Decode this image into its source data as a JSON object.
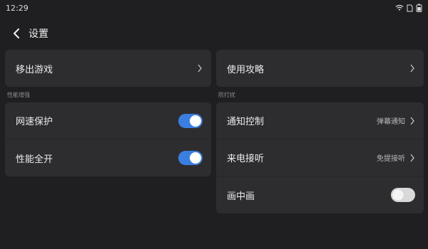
{
  "status": {
    "time": "12:29",
    "icons": [
      "wifi-icon",
      "sim-card-icon",
      "battery-icon"
    ]
  },
  "header": {
    "title": "设置",
    "back_icon": "chevron-left-icon"
  },
  "left": {
    "top_item": {
      "label": "移出游戏"
    },
    "section": "性能增强",
    "items": [
      {
        "label": "网速保护",
        "toggle": "on"
      },
      {
        "label": "性能全开",
        "toggle": "on"
      }
    ]
  },
  "right": {
    "top_item": {
      "label": "使用攻略"
    },
    "section": "防打扰",
    "items": [
      {
        "label": "通知控制",
        "value": "弹幕通知"
      },
      {
        "label": "来电接听",
        "value": "免提接听"
      },
      {
        "label": "画中画",
        "toggle": "off"
      }
    ]
  },
  "colors": {
    "background": "#1f1f21",
    "card": "#2d2d30",
    "accent": "#3a7fe0"
  }
}
